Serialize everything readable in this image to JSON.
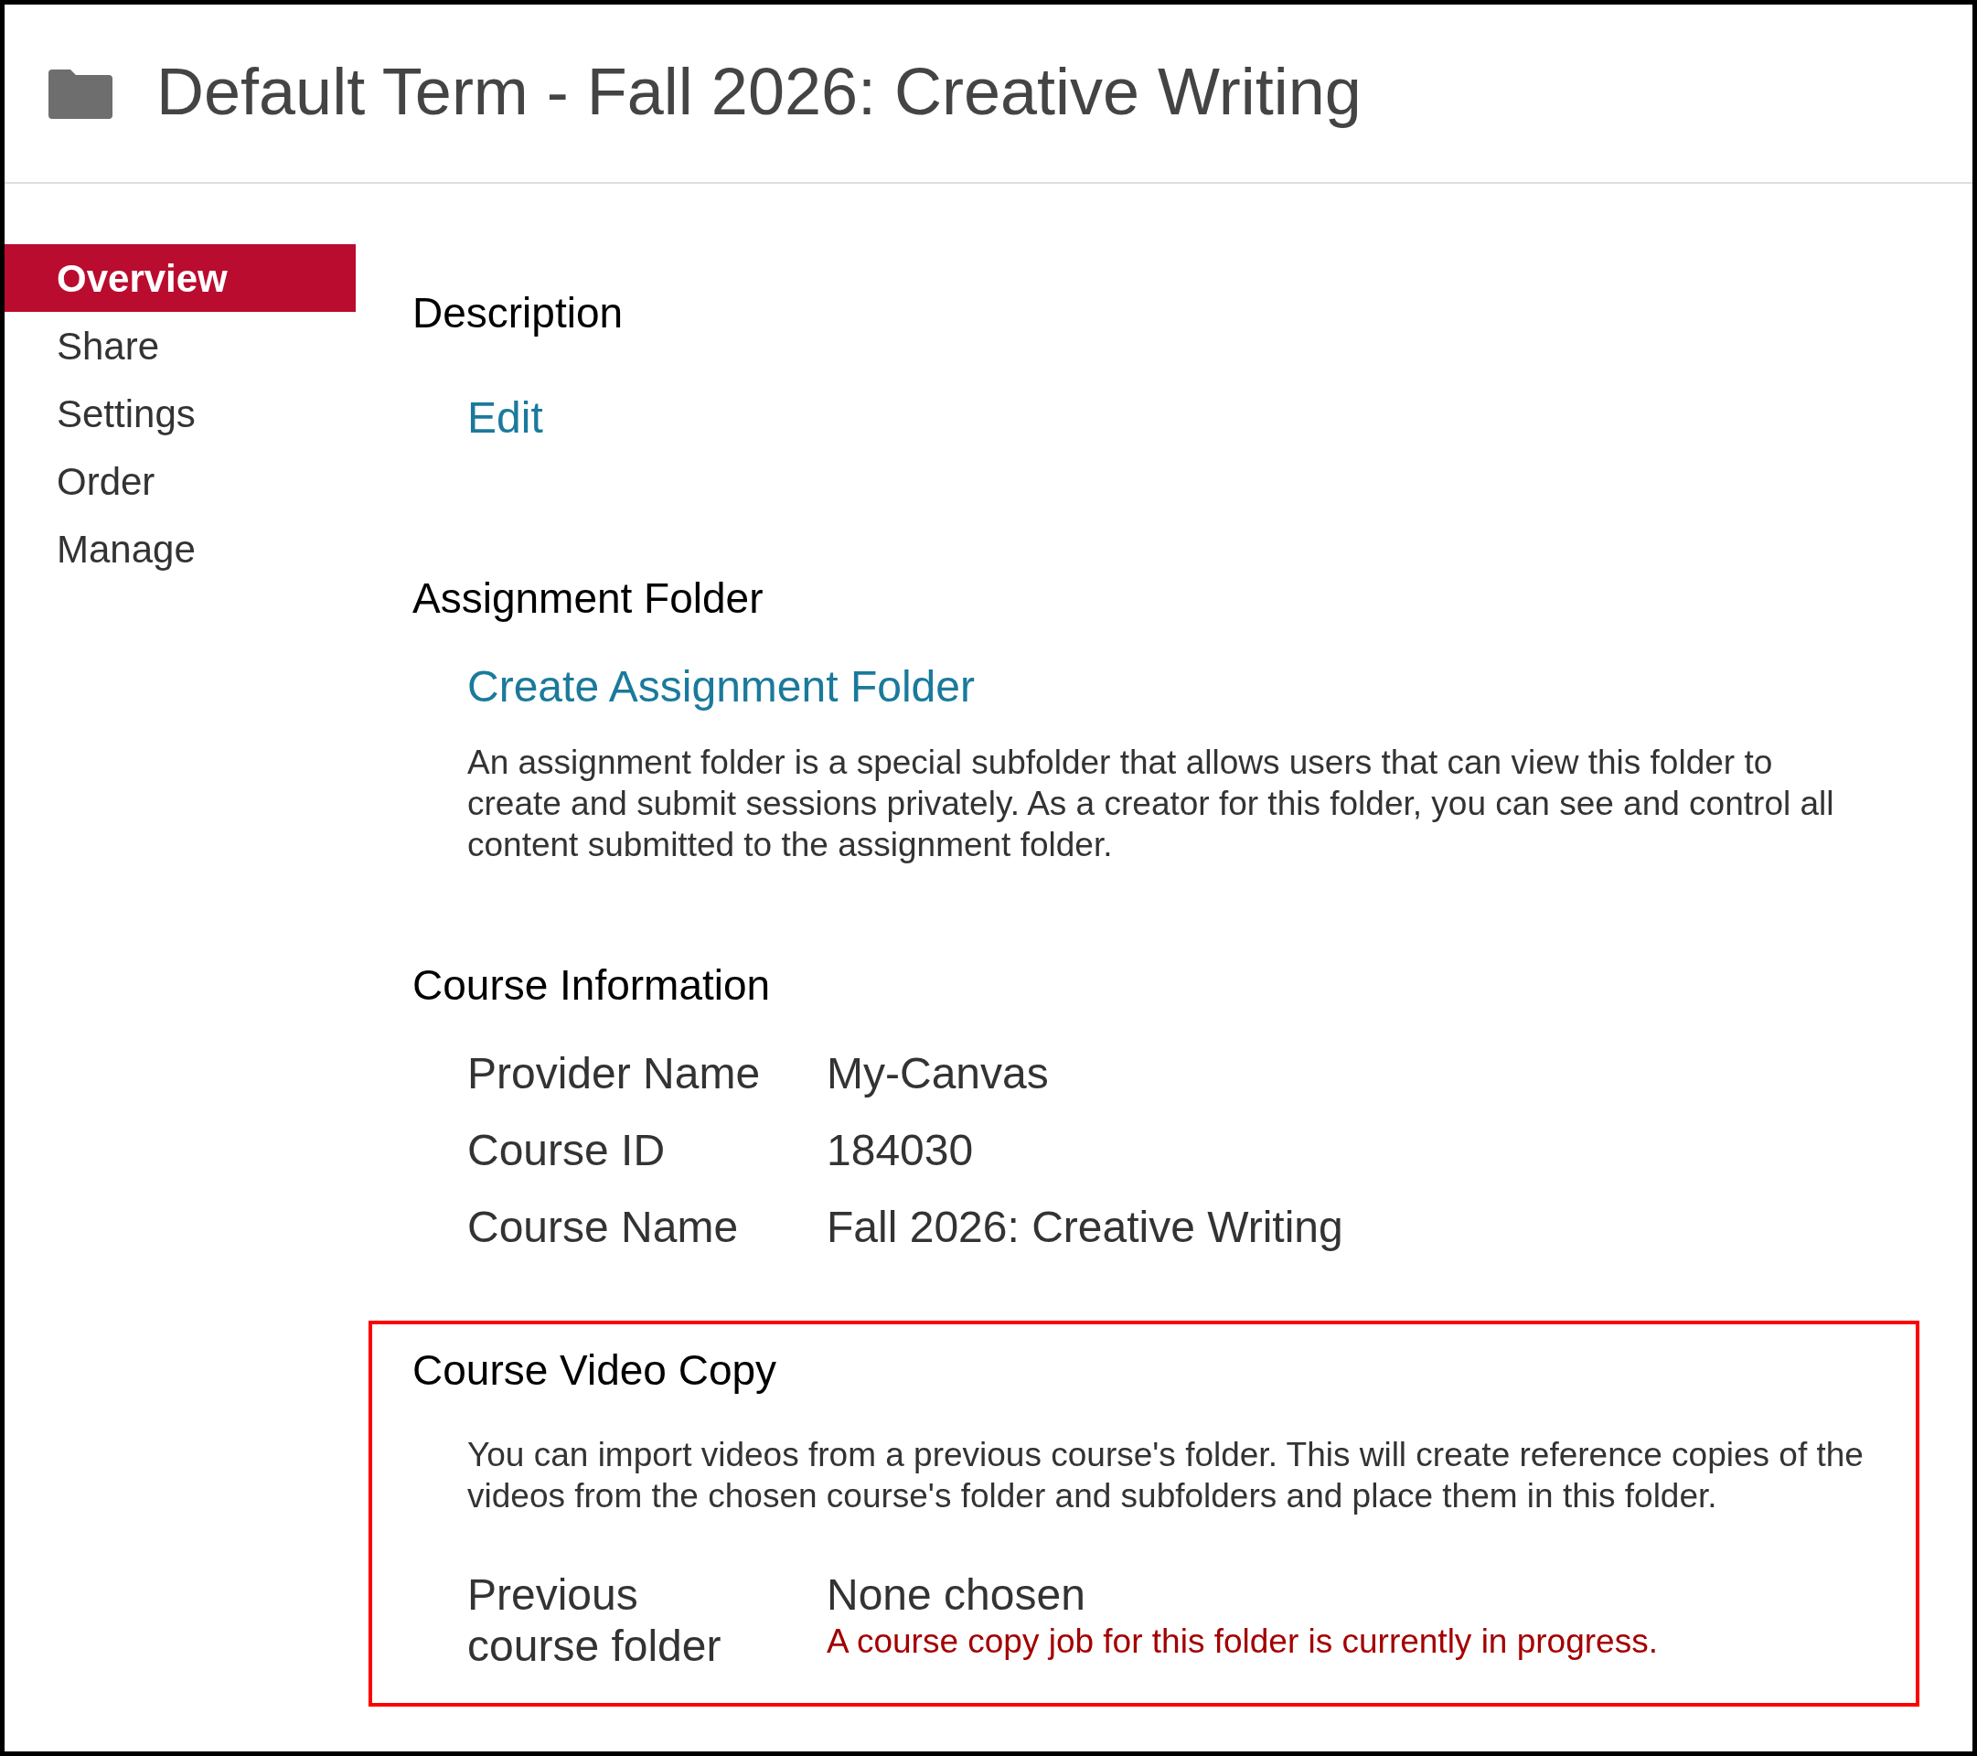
{
  "header": {
    "title": "Default Term - Fall 2026: Creative Writing"
  },
  "sidebar": {
    "items": [
      {
        "label": "Overview",
        "selected": true
      },
      {
        "label": "Share",
        "selected": false
      },
      {
        "label": "Settings",
        "selected": false
      },
      {
        "label": "Order",
        "selected": false
      },
      {
        "label": "Manage",
        "selected": false
      }
    ]
  },
  "description": {
    "heading": "Description",
    "edit_link": "Edit"
  },
  "assignment_folder": {
    "heading": "Assignment Folder",
    "create_link": "Create Assignment Folder",
    "text": "An assignment folder is a special subfolder that allows users that can view this folder to create and submit sessions privately. As a creator for this folder, you can see and control all content submitted to the assignment folder."
  },
  "course_information": {
    "heading": "Course Information",
    "rows": [
      {
        "label": "Provider Name",
        "value": "My-Canvas"
      },
      {
        "label": "Course ID",
        "value": "184030"
      },
      {
        "label": "Course Name",
        "value": "Fall 2026: Creative Writing"
      }
    ]
  },
  "course_video_copy": {
    "heading": "Course Video Copy",
    "highlighted": true,
    "text": "You can import videos from a previous course's folder. This will create reference copies of the videos from the chosen course's folder and subfolders and place them in this folder.",
    "label": "Previous course folder",
    "value": "None chosen",
    "status": "A course copy job for this folder is currently in progress."
  }
}
